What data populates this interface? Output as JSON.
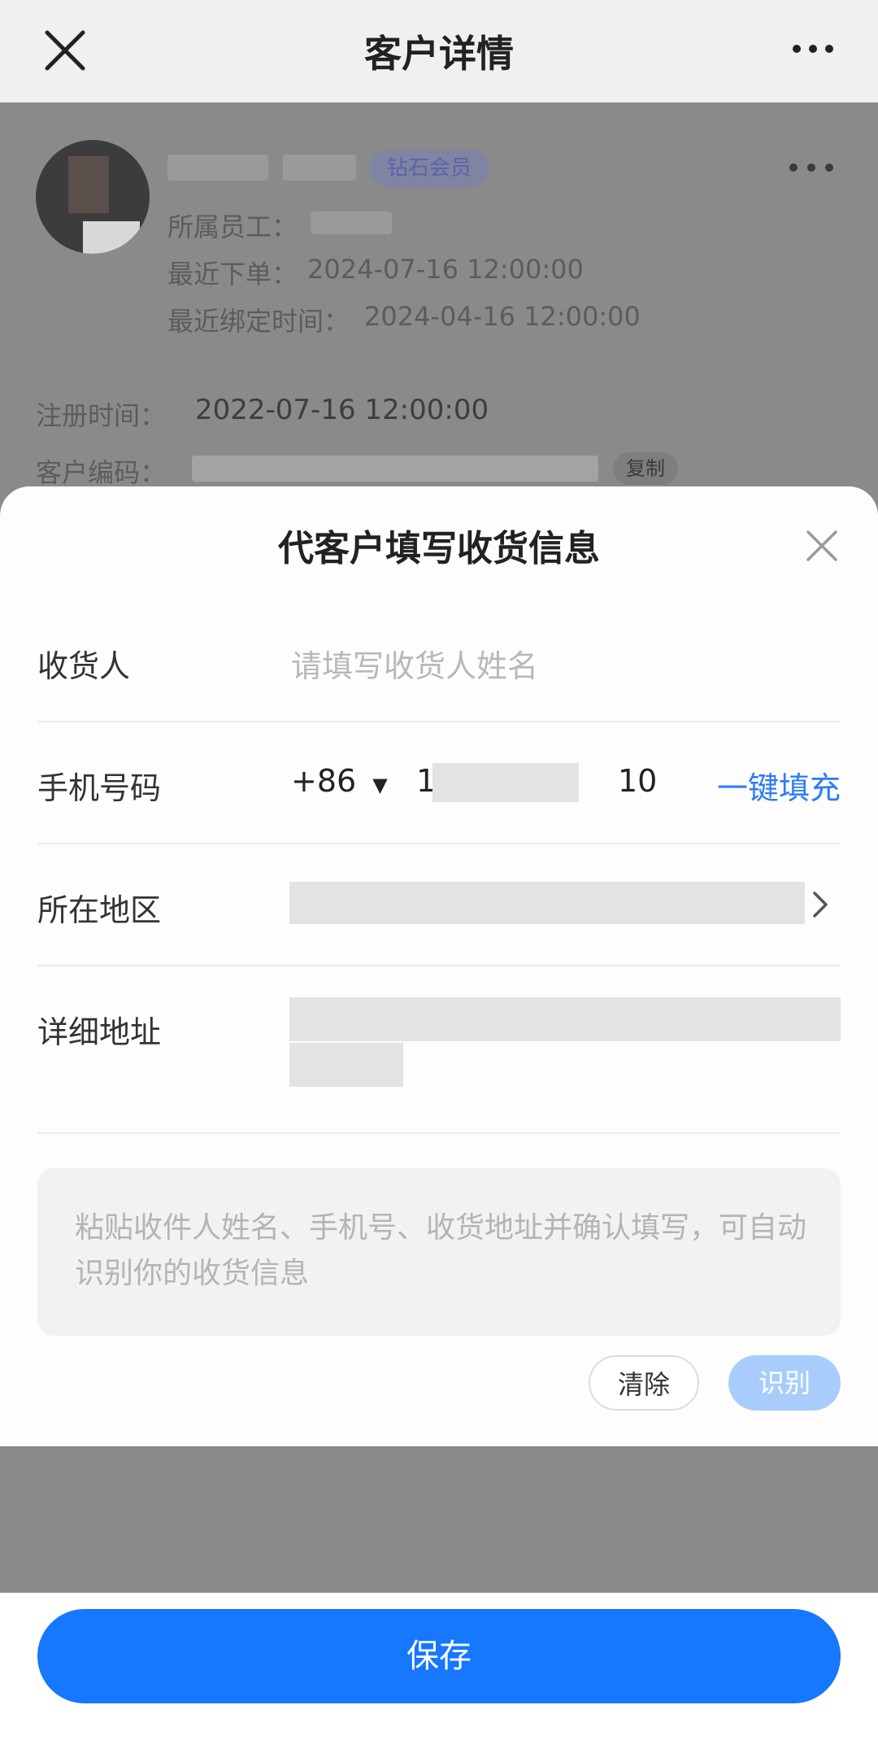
{
  "nav": {
    "title": "客户详情"
  },
  "customer": {
    "badge": "钻石会员",
    "staff_label": "所属员工：",
    "last_order_label": "最近下单：",
    "last_order_time": "2024-07-16 12:00:00",
    "bind_label": "最近绑定时间：",
    "bind_time": "2024-04-16 12:00:00",
    "register_label": "注册时间：",
    "register_time": "2022-07-16 12:00:00",
    "code_label": "客户编码：",
    "copy_label": "复制"
  },
  "sheet": {
    "title": "代客户填写收货信息",
    "receiver_label": "收货人",
    "receiver_placeholder": "请填写收货人姓名",
    "phone_label": "手机号码",
    "country_code": "+86",
    "phone_prefix": "1",
    "phone_suffix": "10",
    "autofill_label": "一键填充",
    "region_label": "所在地区",
    "address_label": "详细地址",
    "paste_placeholder": "粘贴收件人姓名、手机号、收货地址并确认填写，可自动识别你的收货信息",
    "clear_label": "清除",
    "recognize_label": "识别"
  },
  "footer": {
    "save_label": "保存"
  },
  "colors": {
    "primary": "#1677ff",
    "link": "#2f7cf6",
    "recognize_disabled": "#a8cdfc"
  }
}
